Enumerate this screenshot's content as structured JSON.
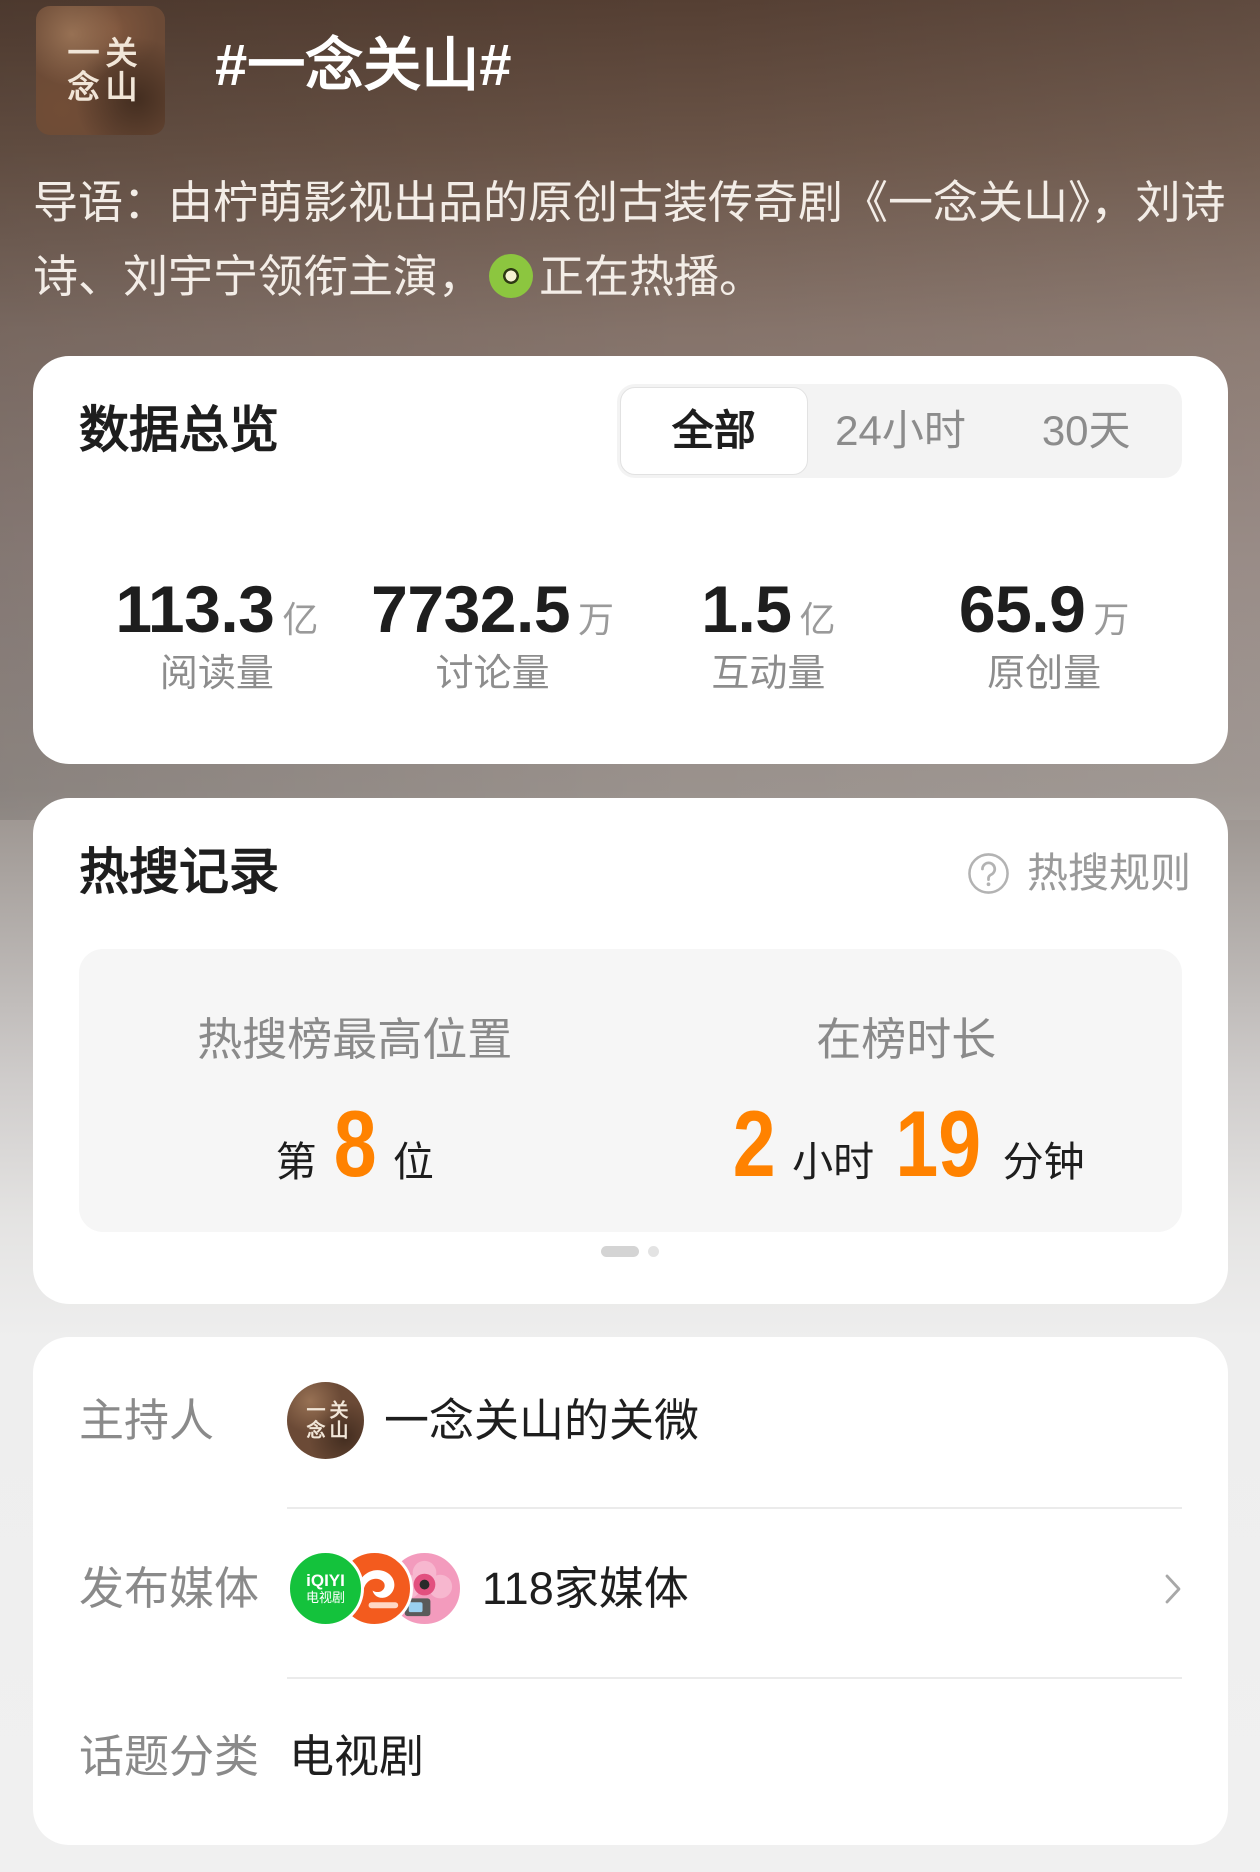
{
  "header": {
    "avatar_logo_text": "一念关山",
    "title": "#一念关山#",
    "intro_text": "导语：由柠萌影视出品的原创古装传奇剧《一念关山》，刘诗诗、刘宇宁领衔主演，",
    "intro_emoji_icon": "kiwi-icon",
    "intro_suffix": "正在热播。"
  },
  "overview": {
    "title": "数据总览",
    "tabs": [
      {
        "label": "全部",
        "selected": true
      },
      {
        "label": "24小时",
        "selected": false
      },
      {
        "label": "30天",
        "selected": false
      }
    ],
    "stats": [
      {
        "value": "113.3",
        "unit": "亿",
        "label": "阅读量"
      },
      {
        "value": "7732.5",
        "unit": "万",
        "label": "讨论量"
      },
      {
        "value": "1.5",
        "unit": "亿",
        "label": "互动量"
      },
      {
        "value": "65.9",
        "unit": "万",
        "label": "原创量"
      }
    ]
  },
  "hot_search": {
    "title": "热搜记录",
    "rules_icon": "question-circle-icon",
    "rules_label": "热搜规则",
    "peak": {
      "label": "热搜榜最高位置",
      "prefix": "第",
      "rank": "8",
      "suffix": "位"
    },
    "duration": {
      "label": "在榜时长",
      "hours": "2",
      "hours_unit": "小时",
      "minutes": "19",
      "minutes_unit": "分钟"
    },
    "pagination": {
      "page_count": 2,
      "current_page": 1
    }
  },
  "info": {
    "host": {
      "label": "主持人",
      "name": "一念关山的关微",
      "avatar_logo_text": "一念关山"
    },
    "media": {
      "label": "发布媒体",
      "count_text": "118家媒体",
      "logos": [
        {
          "icon": "iqiyi-logo",
          "logo_text": "iQIYI",
          "logo_subtext": "电视剧"
        },
        {
          "icon": "orange-media-logo"
        },
        {
          "icon": "pink-media-logo"
        }
      ],
      "chevron_icon": "chevron-right-icon"
    },
    "category": {
      "label": "话题分类",
      "value": "电视剧"
    }
  },
  "colors": {
    "accent": "#ff8200",
    "text_primary": "#1e1e1e",
    "text_secondary": "#8a8a8a",
    "card": "#ffffff",
    "panel": "#f6f6f6",
    "iqiyi_green": "#14c23c",
    "media_orange": "#f35b1e",
    "media_pink": "#f39bbd"
  }
}
